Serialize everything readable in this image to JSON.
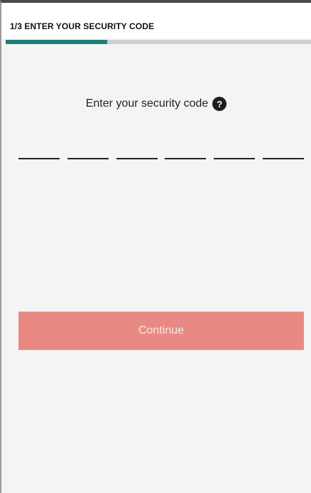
{
  "header": {
    "title": "1/3 ENTER YOUR SECURITY CODE"
  },
  "progress": {
    "step": 1,
    "total": 3,
    "fraction": 0.333,
    "color": "#1a7f74"
  },
  "form": {
    "prompt": "Enter your security code",
    "help_icon": "question-circle-icon",
    "code_digits": [
      "",
      "",
      "",
      "",
      "",
      ""
    ],
    "continue_label": "Continue",
    "continue_color": "#e88a83"
  }
}
